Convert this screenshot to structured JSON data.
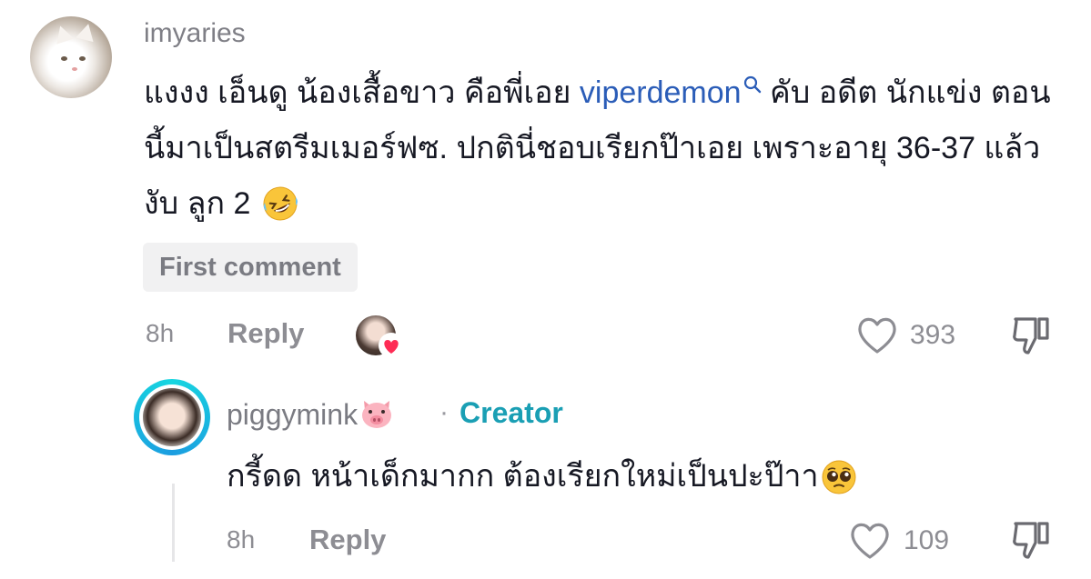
{
  "comment": {
    "username": "imyaries",
    "text_part1": "แงงง เอ็นดู น้องเสื้อขาว คือพี่เอย ",
    "mention": "viperdemon",
    "text_part2": " คับ อดีต นักแข่ง ตอนนี้มาเป็นสตรีมเมอร์ฟซ. ปกตินี่ชอบเรียกป๊าเอย เพราะอายุ 36-37 แล้วงับ ลูก 2 ",
    "badge": "First comment",
    "time": "8h",
    "reply_label": "Reply",
    "like_count": "393",
    "accent_color": "#2b5db8",
    "icons": [
      "search-icon",
      "rofl-emoji",
      "heart-badge-icon",
      "heart-outline-icon",
      "thumbs-down-icon"
    ]
  },
  "reply": {
    "username": "piggymink",
    "separator": "·",
    "creator_label": "Creator",
    "text": "กรี้ดด หน้าเด็กมากก ต้องเรียกใหม่เป็นปะป๊าา",
    "time": "8h",
    "reply_label": "Reply",
    "like_count": "109",
    "accent_color": "#1a9fb4",
    "icons": [
      "pig-face-emoji",
      "pleading-face-emoji",
      "heart-outline-icon",
      "thumbs-down-icon"
    ]
  }
}
